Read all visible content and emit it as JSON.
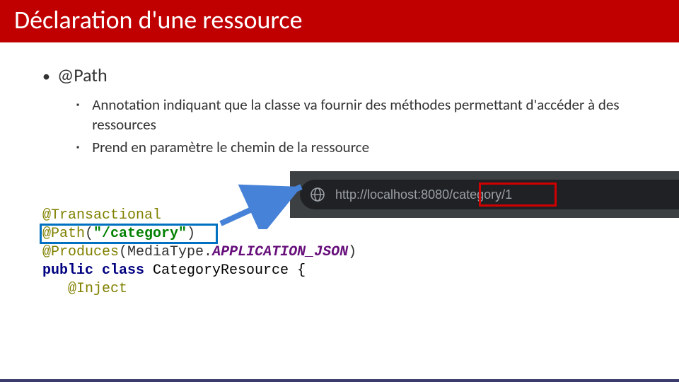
{
  "title": "Déclaration d'une ressource",
  "bullet": {
    "marker": "•",
    "text": "@Path"
  },
  "sub": {
    "marker1": "▪",
    "text1": "Annotation indiquant que la classe va fournir des méthodes permettant d'accéder à des ressources",
    "marker2": "▪",
    "text2": "Prend en paramètre le chemin de la ressource"
  },
  "url": {
    "prefix": "http://localhost:8080",
    "highlight": "/category",
    "tail": "/1"
  },
  "code": {
    "l1a": "@Transactional",
    "l2a": "@Path",
    "l2b": "(",
    "l2c": "\"/category\"",
    "l2d": ")",
    "l3a": "@Produces",
    "l3b": "(MediaType.",
    "l3c": "APPLICATION_JSON",
    "l3d": ")",
    "l4a": "public class ",
    "l4b": "CategoryResource {",
    "l5": "",
    "l6": "   @Inject"
  }
}
